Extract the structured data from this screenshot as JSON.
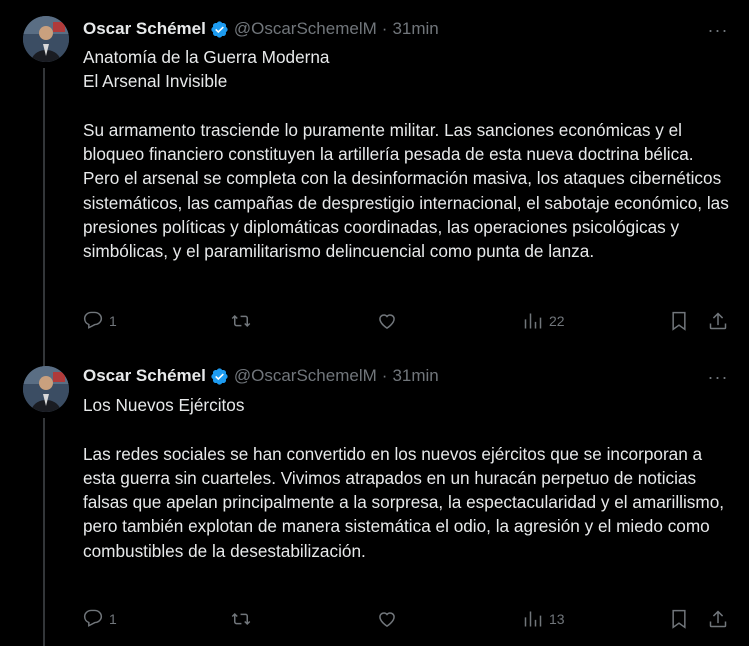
{
  "tweets": [
    {
      "author": "Oscar Schémel",
      "handle": "@OscarSchemelM",
      "separator": "·",
      "time": "31min",
      "more": "···",
      "text": "Anatomía de la Guerra Moderna\nEl Arsenal Invisible\n\nSu armamento trasciende lo puramente militar. Las sanciones económicas y el bloqueo financiero constituyen la artillería pesada de esta nueva doctrina bélica. Pero el arsenal se completa con la desinformación masiva, los ataques cibernéticos sistemáticos, las campañas de desprestigio internacional, el sabotaje económico, las presiones políticas y diplomáticas coordinadas, las operaciones psicológicas y simbólicas, y el paramilitarismo delincuencial como punta de lanza.",
      "replies": "1",
      "reposts": "",
      "likes": "",
      "views": "22"
    },
    {
      "author": "Oscar Schémel",
      "handle": "@OscarSchemelM",
      "separator": "·",
      "time": "31min",
      "more": "···",
      "text": "Los Nuevos Ejércitos\n\nLas redes sociales se han convertido en los nuevos ejércitos que se incorporan a esta guerra sin cuarteles. Vivimos atrapados en un huracán perpetuo de noticias falsas que apelan principalmente a la sorpresa, la espectacularidad y el amarillismo, pero también explotan de manera sistemática el odio, la agresión y el miedo como combustibles de la desestabilización.",
      "replies": "1",
      "reposts": "",
      "likes": "",
      "views": "13"
    }
  ],
  "icons": {
    "verified": "verified-badge-icon",
    "reply": "reply-icon",
    "repost": "repost-icon",
    "like": "heart-icon",
    "views": "views-chart-icon",
    "bookmark": "bookmark-icon",
    "share": "share-icon"
  },
  "colors": {
    "background": "#000000",
    "text": "#e7e9ea",
    "muted": "#71767b",
    "verified": "#1d9bf0",
    "thread_line": "#333639"
  }
}
